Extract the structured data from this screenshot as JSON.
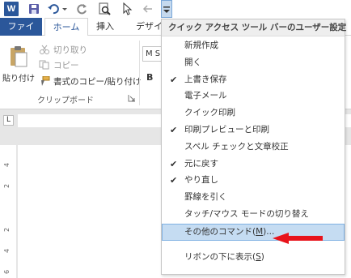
{
  "quick_access": {
    "app_icon_letter": "W",
    "icons": [
      "word-app-icon",
      "save-icon",
      "undo-icon",
      "undo-dropdown-icon",
      "redo-icon",
      "print-preview-icon",
      "cursor-icon",
      "touch-mode-icon",
      "customize-dropdown-icon"
    ]
  },
  "tabs": {
    "file": "ファイル",
    "home": "ホーム",
    "insert": "挿入",
    "design": "デザイ"
  },
  "clipboard": {
    "paste": "貼り付け",
    "cut": "切り取り",
    "copy": "コピー",
    "format_painter": "書式のコピー/貼り付け",
    "group_label": "クリップボード"
  },
  "font": {
    "name_value": "M S",
    "bold": "B"
  },
  "ruler": {
    "tab_selector": "L",
    "vertical_ticks": [
      "4",
      "2",
      "2",
      "4",
      "6"
    ]
  },
  "menu": {
    "title": "クイック アクセス ツール バーのユーザー設定",
    "items": [
      {
        "label": "新規作成",
        "checked": false
      },
      {
        "label": "開く",
        "checked": false
      },
      {
        "label": "上書き保存",
        "checked": true
      },
      {
        "label": "電子メール",
        "checked": false
      },
      {
        "label": "クイック印刷",
        "checked": false
      },
      {
        "label": "印刷プレビューと印刷",
        "checked": true
      },
      {
        "label": "スペル チェックと文章校正",
        "checked": false
      },
      {
        "label": "元に戻す",
        "checked": true
      },
      {
        "label": "やり直し",
        "checked": true
      },
      {
        "label": "罫線を引く",
        "checked": false
      },
      {
        "label": "タッチ/マウス モードの切り替え",
        "checked": false
      }
    ],
    "more_commands": {
      "before": "その他のコマンド(",
      "key": "M",
      "after": ")..."
    },
    "show_below": {
      "before": "リボンの下に表示(",
      "key": "S",
      "after": ")"
    }
  },
  "colors": {
    "accent": "#2b579a",
    "highlight": "#c5dcf2",
    "arrow": "#e8131b"
  }
}
